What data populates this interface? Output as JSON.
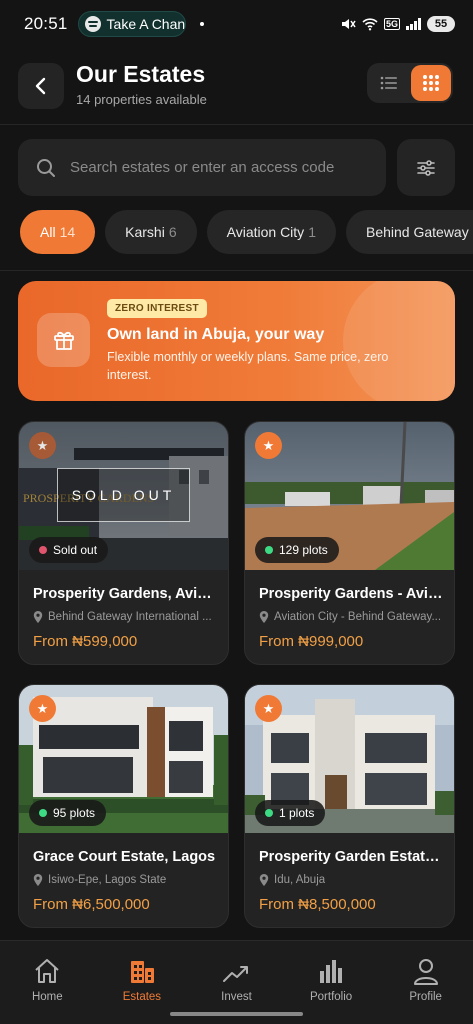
{
  "status_bar": {
    "time": "20:51",
    "media_text": "Take A Chan",
    "signal_label": "5G",
    "battery": "55"
  },
  "header": {
    "title": "Our Estates",
    "subtitle": "14 properties available"
  },
  "search": {
    "placeholder": "Search estates or enter an access code"
  },
  "chips": [
    {
      "label": "All",
      "count": "14"
    },
    {
      "label": "Karshi",
      "count": "6"
    },
    {
      "label": "Aviation City",
      "count": "1"
    },
    {
      "label": "Behind Gateway",
      "count": ""
    }
  ],
  "promo": {
    "badge": "ZERO INTEREST",
    "title": "Own land in Abuja, your way",
    "description": "Flexible monthly or weekly plans. Same price, zero interest."
  },
  "cards": [
    {
      "name": "Prosperity Gardens, Aviat...",
      "location": "Behind Gateway International ...",
      "price": "From ₦599,000",
      "status": "Sold out",
      "overlay": "SOLD OUT",
      "sign_text": "PROSPERITY GARDENS"
    },
    {
      "name": "Prosperity Gardens - Avia...",
      "location": "Aviation City - Behind Gateway...",
      "price": "From ₦999,000",
      "status": "129 plots"
    },
    {
      "name": "Grace Court Estate, Lagos",
      "location": "Isiwo-Epe, Lagos State",
      "price": "From ₦6,500,000",
      "status": "95 plots"
    },
    {
      "name": "Prosperity Garden Estate,...",
      "location": "Idu, Abuja",
      "price": "From ₦8,500,000",
      "status": "1 plots"
    }
  ],
  "bottom_nav": [
    {
      "label": "Home",
      "icon": "home-icon"
    },
    {
      "label": "Estates",
      "icon": "buildings-icon"
    },
    {
      "label": "Invest",
      "icon": "trend-up-icon"
    },
    {
      "label": "Portfolio",
      "icon": "bar-chart-icon"
    },
    {
      "label": "Profile",
      "icon": "person-icon"
    }
  ],
  "colors": {
    "accent": "#f07a35",
    "background": "#141414",
    "price": "#f2a045",
    "available_dot": "#3ddc84",
    "sold_dot": "#e0556d"
  }
}
